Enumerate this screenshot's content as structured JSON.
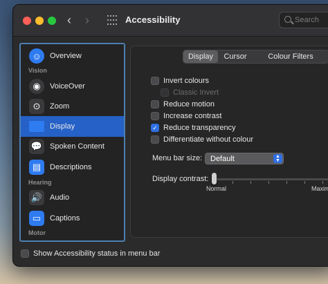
{
  "window": {
    "title": "Accessibility"
  },
  "search": {
    "placeholder": "Search"
  },
  "sidebar": {
    "sections": [
      "Vision",
      "Hearing",
      "Motor"
    ],
    "items": [
      {
        "label": "Overview",
        "icon": "accessibility-icon",
        "color": "#2f7bf0"
      },
      {
        "label": "VoiceOver",
        "icon": "voiceover-icon",
        "color": "#3a3a3c"
      },
      {
        "label": "Zoom",
        "icon": "zoom-icon",
        "color": "#3a3a3c"
      },
      {
        "label": "Display",
        "icon": "display-icon",
        "color": "#2f7bf0"
      },
      {
        "label": "Spoken Content",
        "icon": "speech-bubble-icon",
        "color": "#3a3a3c"
      },
      {
        "label": "Descriptions",
        "icon": "descriptions-icon",
        "color": "#2f7bf0"
      },
      {
        "label": "Audio",
        "icon": "speaker-icon",
        "color": "#3a3a3c"
      },
      {
        "label": "Captions",
        "icon": "captions-icon",
        "color": "#2f7bf0"
      }
    ],
    "selected": "Display"
  },
  "tabs": [
    "Display",
    "Cursor",
    "Colour Filters"
  ],
  "active_tab": "Display",
  "options": [
    {
      "label": "Invert colours",
      "checked": false,
      "enabled": true
    },
    {
      "label": "Classic Invert",
      "checked": false,
      "enabled": false
    },
    {
      "label": "Reduce motion",
      "checked": false,
      "enabled": true
    },
    {
      "label": "Increase contrast",
      "checked": false,
      "enabled": true
    },
    {
      "label": "Reduce transparency",
      "checked": true,
      "enabled": true
    },
    {
      "label": "Differentiate without colour",
      "checked": false,
      "enabled": true
    }
  ],
  "menu_bar_size": {
    "label": "Menu bar size:",
    "value": "Default"
  },
  "display_contrast": {
    "label": "Display contrast:",
    "min_label": "Normal",
    "max_label": "Maxim",
    "level": 0
  },
  "footer": {
    "status_label": "Show Accessibility status in menu bar",
    "checked": false
  },
  "colors": {
    "accent": "#2f6fe4",
    "selection": "#2561c7"
  }
}
